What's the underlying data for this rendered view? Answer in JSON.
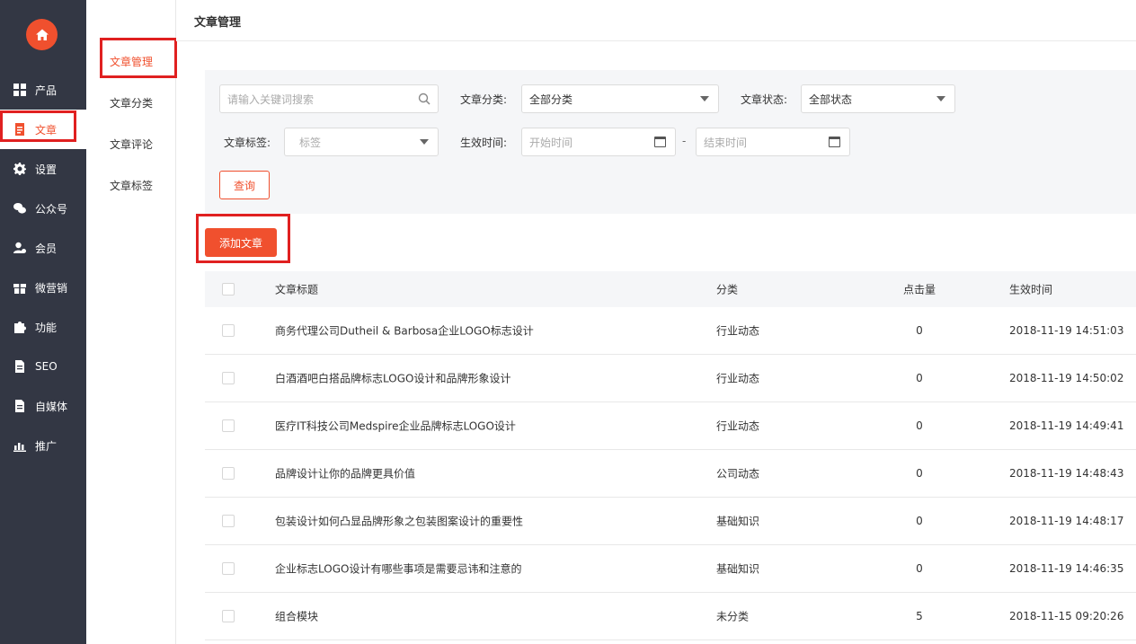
{
  "sidebar": {
    "items": [
      {
        "label": "产品",
        "icon": "grid-icon",
        "active": false
      },
      {
        "label": "文章",
        "icon": "document-icon",
        "active": true
      },
      {
        "label": "设置",
        "icon": "gear-icon",
        "active": false
      },
      {
        "label": "公众号",
        "icon": "wechat-icon",
        "active": false
      },
      {
        "label": "会员",
        "icon": "member-icon",
        "active": false
      },
      {
        "label": "微营销",
        "icon": "gift-icon",
        "active": false
      },
      {
        "label": "功能",
        "icon": "puzzle-icon",
        "active": false
      },
      {
        "label": "SEO",
        "icon": "file-icon",
        "active": false
      },
      {
        "label": "自媒体",
        "icon": "file-icon",
        "active": false
      },
      {
        "label": "推广",
        "icon": "bar-chart-icon",
        "active": false
      }
    ]
  },
  "submenu": {
    "items": [
      {
        "label": "文章管理",
        "active": true
      },
      {
        "label": "文章分类",
        "active": false
      },
      {
        "label": "文章评论",
        "active": false
      },
      {
        "label": "文章标签",
        "active": false
      }
    ]
  },
  "header": {
    "title": "文章管理"
  },
  "filters": {
    "search_placeholder": "请输入关键词搜索",
    "category_label": "文章分类:",
    "category_value": "全部分类",
    "status_label": "文章状态:",
    "status_value": "全部状态",
    "tag_label": "文章标签:",
    "tag_placeholder": "标签",
    "time_label": "生效时间:",
    "start_placeholder": "开始时间",
    "end_placeholder": "结束时间",
    "range_separator": "-",
    "query_label": "查询"
  },
  "actions": {
    "add_label": "添加文章"
  },
  "table": {
    "headers": {
      "title": "文章标题",
      "category": "分类",
      "clicks": "点击量",
      "time": "生效时间"
    },
    "rows": [
      {
        "title": "商务代理公司Dutheil & Barbosa企业LOGO标志设计",
        "category": "行业动态",
        "clicks": "0",
        "time": "2018-11-19 14:51:03"
      },
      {
        "title": "白酒酒吧白搭品牌标志LOGO设计和品牌形象设计",
        "category": "行业动态",
        "clicks": "0",
        "time": "2018-11-19 14:50:02"
      },
      {
        "title": "医疗IT科技公司Medspire企业品牌标志LOGO设计",
        "category": "行业动态",
        "clicks": "0",
        "time": "2018-11-19 14:49:41"
      },
      {
        "title": "品牌设计让你的品牌更具价值",
        "category": "公司动态",
        "clicks": "0",
        "time": "2018-11-19 14:48:43"
      },
      {
        "title": "包装设计如何凸显品牌形象之包装图案设计的重要性",
        "category": "基础知识",
        "clicks": "0",
        "time": "2018-11-19 14:48:17"
      },
      {
        "title": "企业标志LOGO设计有哪些事项是需要忌讳和注意的",
        "category": "基础知识",
        "clicks": "0",
        "time": "2018-11-19 14:46:35"
      },
      {
        "title": "组合模块",
        "category": "未分类",
        "clicks": "5",
        "time": "2018-11-15 09:20:26"
      }
    ]
  },
  "colors": {
    "accent": "#f0502e",
    "sidebar_bg": "#333744",
    "highlight_box": "#e02020"
  }
}
